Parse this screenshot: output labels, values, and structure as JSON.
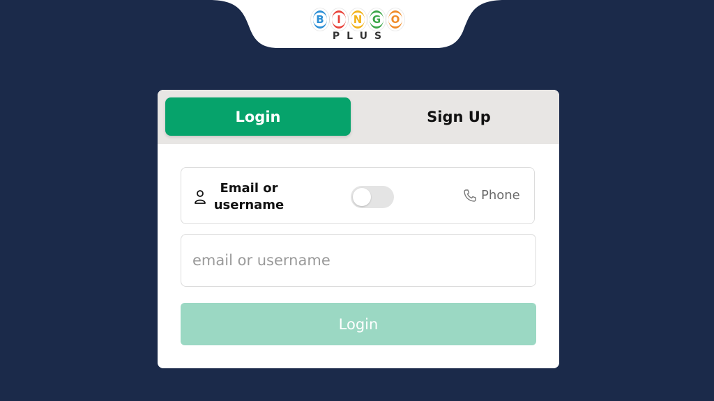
{
  "logo": {
    "letters": [
      "B",
      "I",
      "N",
      "G",
      "O"
    ],
    "letter_colors": [
      "#2c8fd6",
      "#e8423a",
      "#f2b319",
      "#3aa547",
      "#f08a26"
    ],
    "sub": "PLUS"
  },
  "tabs": {
    "login_label": "Login",
    "signup_label": "Sign Up"
  },
  "login_method": {
    "email_label": "Email or username",
    "phone_label": "Phone",
    "user_icon": "user-icon",
    "phone_icon": "phone-icon",
    "toggle_on": false
  },
  "form": {
    "email_placeholder": "email or username",
    "email_value": "",
    "submit_label": "Login"
  },
  "colors": {
    "background": "#1b2a4a",
    "accent": "#06a36b",
    "submit_disabled": "#9bd8c3"
  }
}
